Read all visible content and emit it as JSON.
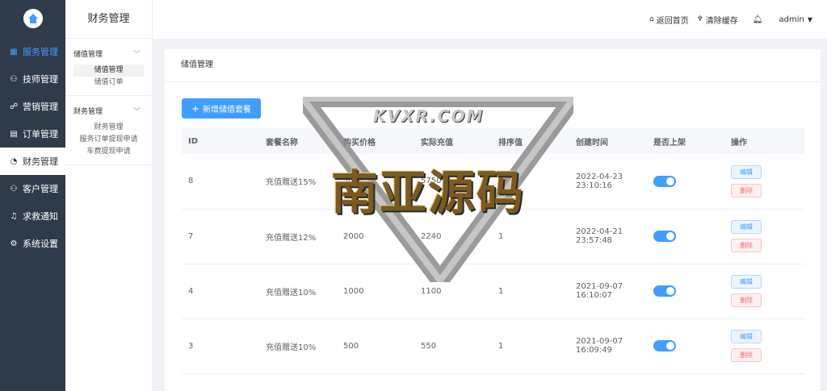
{
  "sidebar": {
    "items": [
      {
        "label": "服务管理",
        "icon": "grid-icon",
        "state": "blue"
      },
      {
        "label": "技师管理",
        "icon": "user-icon",
        "state": ""
      },
      {
        "label": "营销管理",
        "icon": "share-icon",
        "state": ""
      },
      {
        "label": "订单管理",
        "icon": "document-icon",
        "state": ""
      },
      {
        "label": "财务管理",
        "icon": "pie-icon",
        "state": "active"
      },
      {
        "label": "客户管理",
        "icon": "user-icon",
        "state": ""
      },
      {
        "label": "求救通知",
        "icon": "bell-icon",
        "state": ""
      },
      {
        "label": "系统设置",
        "icon": "gear-icon",
        "state": ""
      }
    ]
  },
  "subbar": {
    "title": "财务管理",
    "groups": [
      {
        "head": "储值管理",
        "links": [
          "储值管理",
          "储值订单"
        ]
      },
      {
        "head": "财务管理",
        "links": [
          "财务管理",
          "服务订单提现申请",
          "车费提现申请"
        ]
      }
    ]
  },
  "header": {
    "home": "返回首页",
    "clear_cache": "清除缓存",
    "user": "admin"
  },
  "main": {
    "title": "储值管理",
    "add_button": "新增储值套餐",
    "columns": [
      "ID",
      "套餐名称",
      "购买价格",
      "实际充值",
      "排序值",
      "创建时间",
      "是否上架",
      "操作"
    ],
    "rows": [
      {
        "id": "8",
        "name": "充值赠送15%",
        "price": "5000",
        "actual": "5750",
        "sort": "1",
        "created_date": "2022-04-23",
        "created_time": "23:10:16"
      },
      {
        "id": "7",
        "name": "充值赠送12%",
        "price": "2000",
        "actual": "2240",
        "sort": "1",
        "created_date": "2022-04-21",
        "created_time": "23:57:48"
      },
      {
        "id": "4",
        "name": "充值赠送10%",
        "price": "1000",
        "actual": "1100",
        "sort": "1",
        "created_date": "2021-09-07",
        "created_time": "16:10:07"
      },
      {
        "id": "3",
        "name": "充值赠送10%",
        "price": "500",
        "actual": "550",
        "sort": "1",
        "created_date": "2021-09-07",
        "created_time": "16:09:49"
      }
    ],
    "edit_label": "编辑",
    "delete_label": "删除"
  },
  "watermark": {
    "top": "KVXR.COM",
    "main": "南亚源码"
  },
  "colors": {
    "sidebar_bg": "#2f3b4b",
    "primary": "#409eff",
    "danger": "#f56c6c"
  }
}
